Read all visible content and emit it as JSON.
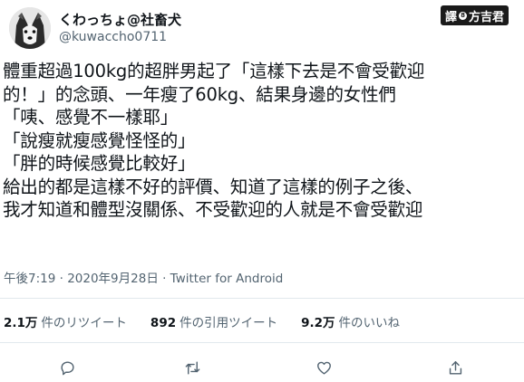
{
  "header": {
    "display_name": "くわっちょ@社畜犬",
    "handle": "@kuwaccho0711",
    "avatar_icon": "husky-dog-avatar"
  },
  "watermark": {
    "left": "譯",
    "middle": "8",
    "right": "方吉君"
  },
  "tweet": {
    "lines": [
      "體重超過100kg的超胖男起了「這樣下去是不會受歡迎",
      "的！」的念頭、一年瘦了60kg、結果身邊的女性們",
      "「咦、感覺不一樣耶」",
      "「說瘦就瘦感覺怪怪的」",
      "「胖的時候感覺比較好」",
      "給出的都是這樣不好的評價、知道了這樣的例子之後、",
      "我才知道和體型沒關係、不受歡迎的人就是不會受歡迎"
    ]
  },
  "meta": {
    "timestamp": "午後7:19 · 2020年9月28日 · Twitter for Android"
  },
  "stats": {
    "retweets": {
      "count": "2.1万",
      "label": "件のリツイート"
    },
    "quotes": {
      "count": "892",
      "label": "件の引用ツイート"
    },
    "likes": {
      "count": "9.2万",
      "label": "件のいいね"
    }
  },
  "actions": {
    "icons": [
      "reply-icon",
      "retweet-icon",
      "like-icon",
      "share-icon"
    ],
    "icon_color": "#536471"
  }
}
